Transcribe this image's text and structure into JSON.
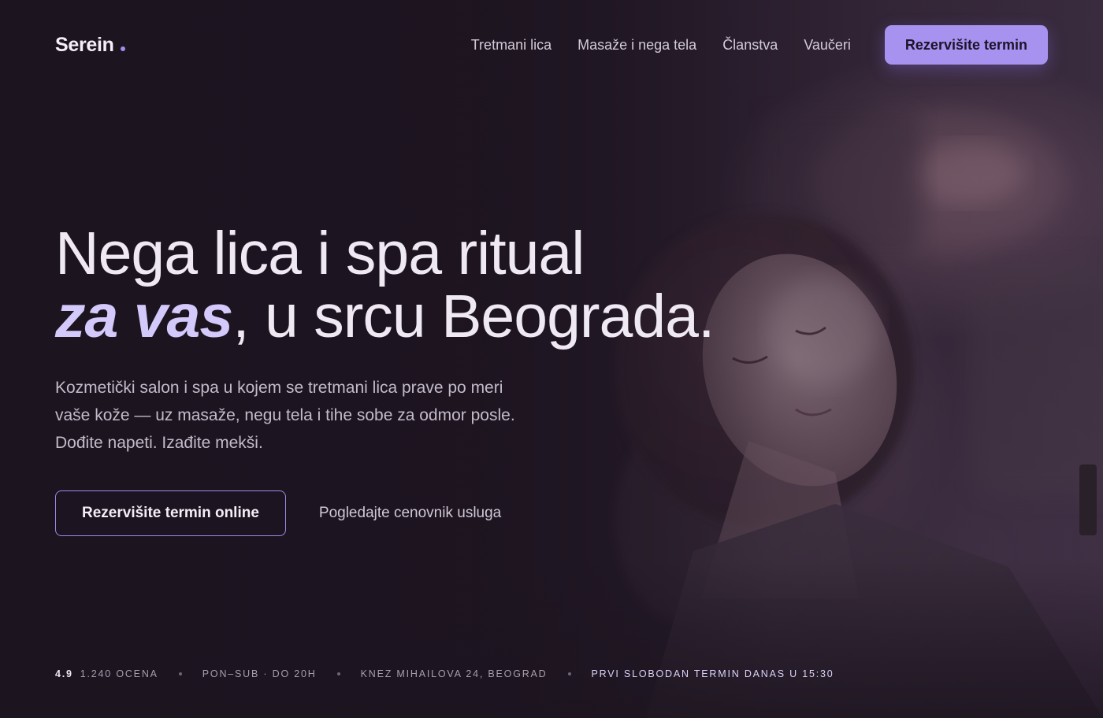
{
  "brand": {
    "name": "Serein",
    "accent_color": "#a48bf0"
  },
  "nav": {
    "links": [
      "Tretmani lica",
      "Masaže i nega tela",
      "Članstva",
      "Vaučeri"
    ],
    "cta": "Rezervišite termin"
  },
  "hero": {
    "headline_line1": "Nega lica i spa ritual",
    "headline_accent": "za vas",
    "headline_rest": ", u srcu Beograda.",
    "lead": "Kozmetički salon i spa u kojem se tretmani lica prave po meri vaše kože — uz masaže, negu tela i tihe sobe za odmor posle. Dođite napeti. Izađite mekši.",
    "primary_cta": "Rezervišite termin online",
    "secondary_cta": "Pogledajte cenovnik usluga"
  },
  "info_strip": {
    "rating": "4.9",
    "reviews": "1.240 ocena",
    "hours": "Pon–Sub · do 20h",
    "address": "Knez Mihailova 24, Beograd",
    "next_slot": "Prvi slobodan termin danas u 15:30"
  },
  "colors": {
    "background": "#1c141f",
    "accent_button": "#a792f0",
    "accent_text": "#d3c9fb"
  }
}
